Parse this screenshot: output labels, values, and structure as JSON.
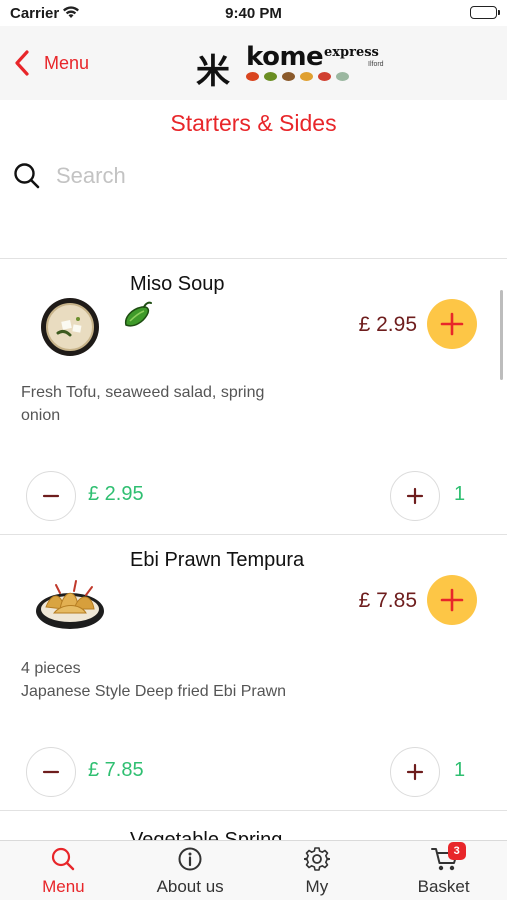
{
  "status_bar": {
    "carrier": "Carrier",
    "time": "9:40 PM"
  },
  "nav": {
    "back_label": "Menu",
    "logo": {
      "mark": "米",
      "brand": "kome",
      "sub": "express",
      "location": "Ilford"
    }
  },
  "page_title": "Starters & Sides",
  "search": {
    "placeholder": "Search",
    "value": ""
  },
  "colors": {
    "accent": "#e8262a",
    "add_button": "#fdc646",
    "price": "#6e1d1d",
    "line_price": "#2fbf71"
  },
  "items": [
    {
      "name": "Miso Soup",
      "vegetarian_icon": "green-pepper-icon",
      "price": "£ 2.95",
      "description": "Fresh Tofu, seaweed salad, spring\nonion",
      "line_price": "£ 2.95",
      "quantity": "1"
    },
    {
      "name": "Ebi Prawn Tempura",
      "price": "£ 7.85",
      "description": "4 pieces\nJapanese Style Deep fried Ebi Prawn",
      "line_price": "£ 7.85",
      "quantity": "1"
    },
    {
      "name": "Vegetable Spring"
    }
  ],
  "tabs": [
    {
      "label": "Menu",
      "icon": "search-icon",
      "active": true
    },
    {
      "label": "About us",
      "icon": "info-icon",
      "active": false
    },
    {
      "label": "My",
      "icon": "gear-icon",
      "active": false
    },
    {
      "label": "Basket",
      "icon": "cart-icon",
      "badge": "3",
      "active": false
    }
  ]
}
